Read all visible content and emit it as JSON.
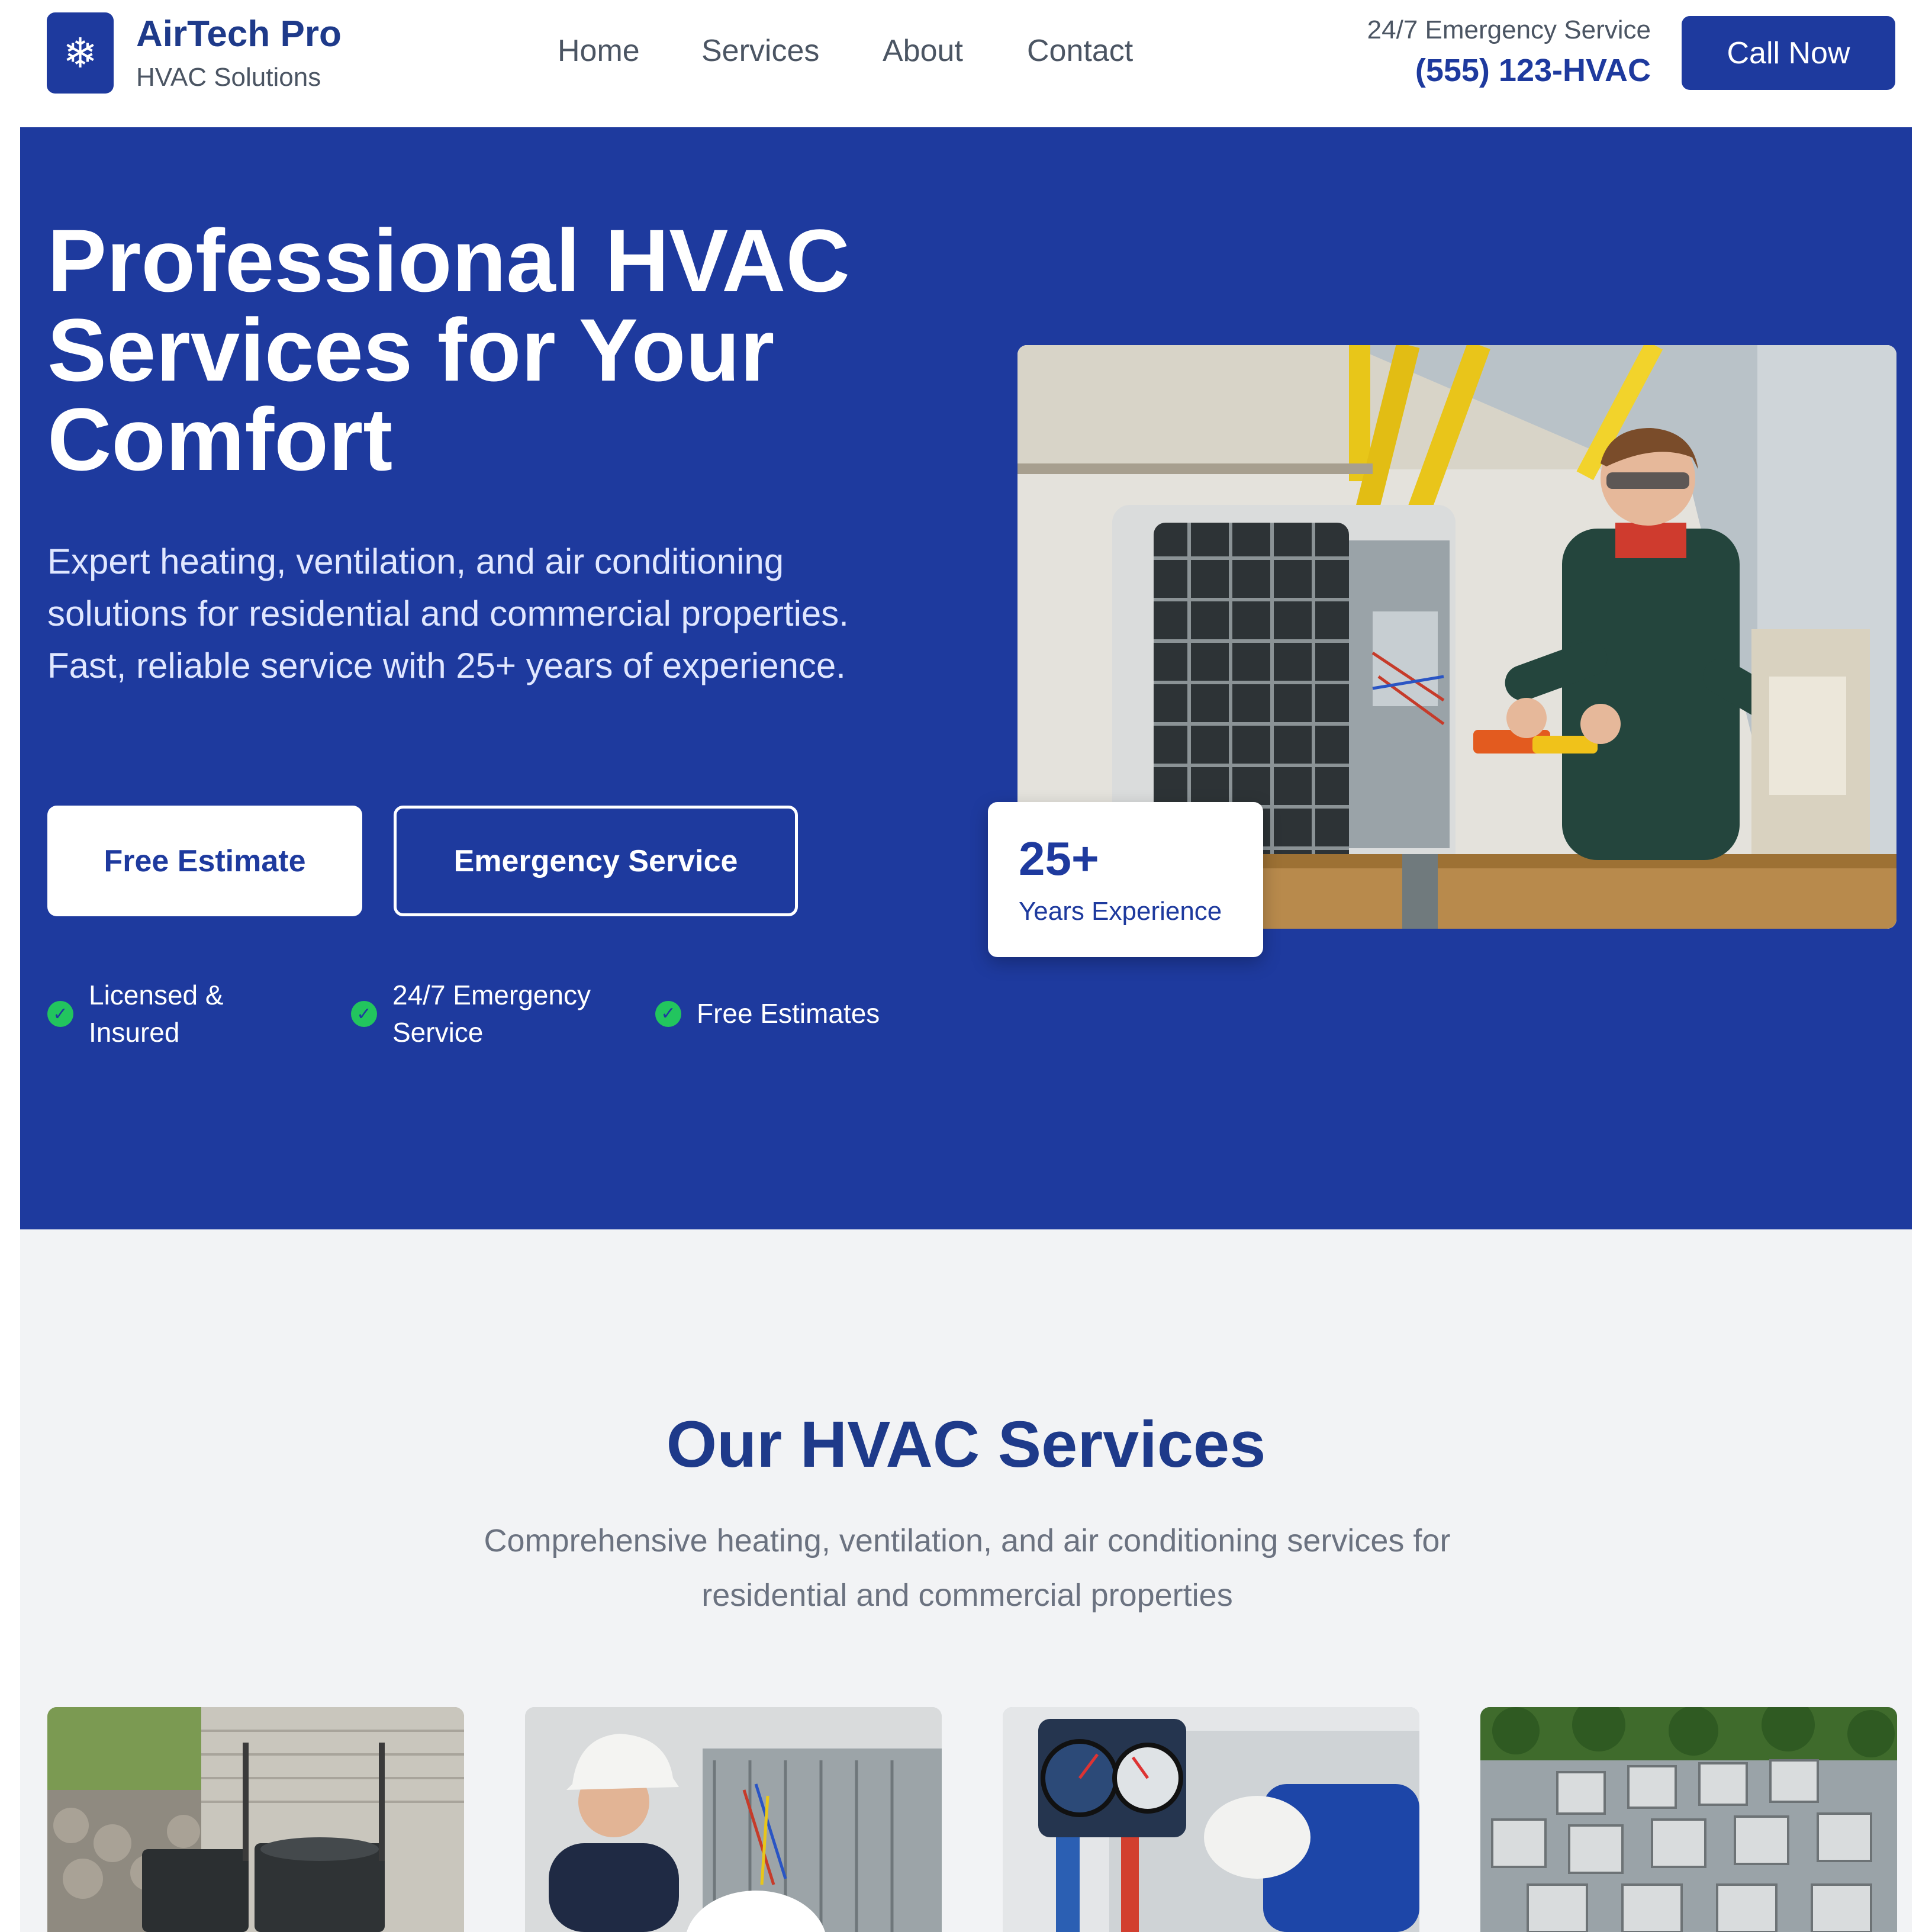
{
  "header": {
    "brand_name": "AirTech Pro",
    "brand_sub": "HVAC Solutions",
    "logo_icon": "snowflake-icon",
    "nav": [
      "Home",
      "Services",
      "About",
      "Contact"
    ],
    "emergency_label": "24/7 Emergency Service",
    "phone": "(555) 123-HVAC",
    "call_button": "Call Now"
  },
  "hero": {
    "title": "Professional HVAC Services for Your Comfort",
    "description": "Expert heating, ventilation, and air conditioning solutions for residential and commercial properties. Fast, reliable service with 25+ years of experience.",
    "primary_button": "Free Estimate",
    "secondary_button": "Emergency Service",
    "features": [
      "Licensed & Insured",
      "24/7 Emergency Service",
      "Free Estimates"
    ],
    "experience_number": "25+",
    "experience_label": "Years Experience"
  },
  "services": {
    "title": "Our HVAC Services",
    "description": "Comprehensive heating, ventilation, and air conditioning services for residential and commercial properties"
  },
  "colors": {
    "brand_blue": "#1e3a9e",
    "check_green": "#22c55e",
    "section_bg": "#f2f3f5"
  }
}
